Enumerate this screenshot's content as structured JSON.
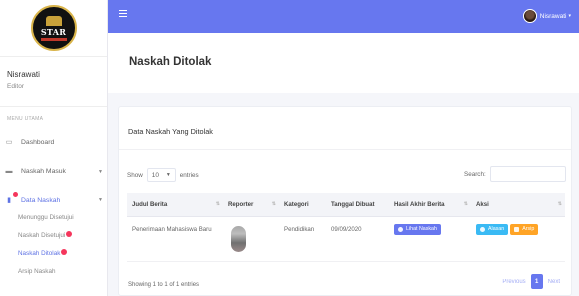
{
  "brand": {
    "logo_text": "STAR"
  },
  "user": {
    "name": "Nisrawati",
    "role": "Editor"
  },
  "topbar": {
    "user_name": "Nisrawati",
    "caret": "▾"
  },
  "sidebar": {
    "menu_header": "MENU UTAMA",
    "items": [
      {
        "label": "Dashboard",
        "icon": "monitor-icon"
      },
      {
        "label": "Naskah Masuk",
        "icon": "inbox-icon"
      },
      {
        "label": "Data Naskah",
        "icon": "file-icon"
      }
    ],
    "sub_items": [
      {
        "label": "Menunggu Disetujui"
      },
      {
        "label": "Naskah Disetujui"
      },
      {
        "label": "Naskah Ditolak"
      },
      {
        "label": "Arsip Naskah"
      }
    ]
  },
  "page": {
    "title": "Naskah Ditolak"
  },
  "card": {
    "title": "Data Naskah Yang Ditolak",
    "show_label": "Show",
    "entries_value": "10",
    "entries_label": "entries",
    "search_label": "Search:",
    "search_value": ""
  },
  "table": {
    "headers": [
      "Judul Berita",
      "Reporter",
      "Kategori",
      "Tanggal Dibuat",
      "Hasil Akhir Berita",
      "Aksi"
    ],
    "rows": [
      {
        "judul": "Penerimaan Mahasiswa Baru",
        "kategori": "Pendidikan",
        "tanggal": "09/09/2020",
        "hasil_button": "Lihat Naskah",
        "alasan_button": "Alasan",
        "arsip_button": "Arsip"
      }
    ]
  },
  "footer": {
    "showing": "Showing 1 to 1 of 1 entries",
    "previous": "Previous",
    "current_page": "1",
    "next": "Next"
  },
  "colors": {
    "accent": "#6777ef",
    "info": "#3abaf4",
    "warning": "#ffa426",
    "danger": "#f5365c"
  }
}
